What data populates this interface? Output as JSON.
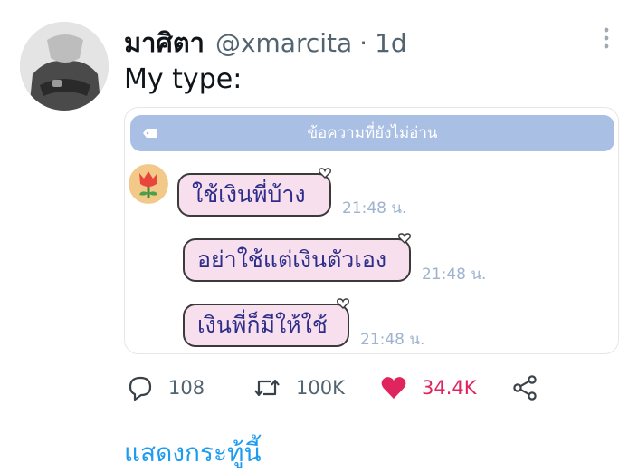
{
  "tweet": {
    "author_name": "มาศิตา",
    "author_handle": "@xmarcita",
    "separator": "·",
    "timestamp": "1d",
    "text": "My type:",
    "avatar_icon": "profile-photo",
    "more_icon": "more-vertical-icon"
  },
  "media": {
    "unread_banner": "ข้อความที่ยังไม่อ่าน",
    "bubble_color": "#f7dfee",
    "banner_color": "#a9bfe3",
    "messages": [
      {
        "text": "ใช้เงินพี่บ้าง",
        "time": "21:48 น."
      },
      {
        "text": "อย่าใช้แต่เงินตัวเอง",
        "time": "21:48 น."
      },
      {
        "text": "เงินพี่ก็มีให้ใช้",
        "time": "21:48 น."
      }
    ]
  },
  "actions": {
    "reply_count": "108",
    "retweet_count": "100K",
    "like_count": "34.4K",
    "like_color": "#e0245e",
    "share_icon": "share-icon"
  },
  "show_thread": "แสดงกระทู้นี้",
  "accent_color": "#1d9bf0"
}
